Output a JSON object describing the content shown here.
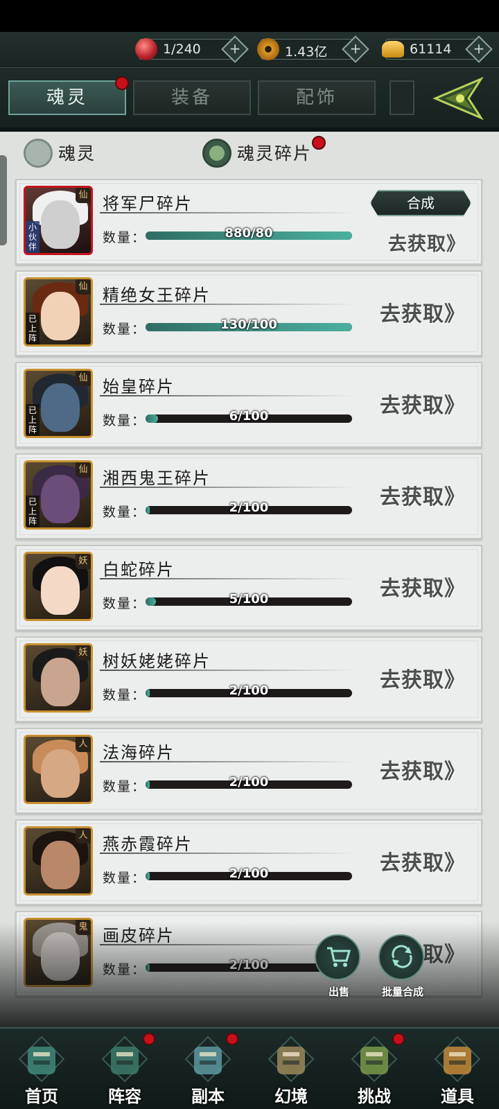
{
  "resources": [
    {
      "name": "soul-orb",
      "value": "1/240",
      "color": "#c4323a"
    },
    {
      "name": "coin",
      "value": "1.43亿",
      "color": "#c98a1e"
    },
    {
      "name": "ingot",
      "value": "61114",
      "color": "#e0a92a"
    }
  ],
  "tabs": [
    {
      "label": "魂灵",
      "active": true,
      "badge": true
    },
    {
      "label": "装备",
      "active": false,
      "badge": false
    },
    {
      "label": "配饰",
      "active": false,
      "badge": false
    }
  ],
  "subtabs": [
    {
      "label": "魂灵",
      "selected": false,
      "badge": false
    },
    {
      "label": "魂灵碎片",
      "selected": true,
      "badge": true
    }
  ],
  "qty_label": "数量：",
  "go_label": "去获取》",
  "compose_label": "合成",
  "fragments": [
    {
      "name": "将军尸碎片",
      "current": 880,
      "required": 80,
      "text": "880/80",
      "grade": "仙",
      "tag": "小伙伴",
      "frame": "red",
      "compose": true
    },
    {
      "name": "精绝女王碎片",
      "current": 130,
      "required": 100,
      "text": "130/100",
      "grade": "仙",
      "tag": "已上阵",
      "frame": "gold",
      "compose": false
    },
    {
      "name": "始皇碎片",
      "current": 6,
      "required": 100,
      "text": "6/100",
      "grade": "仙",
      "tag": "已上阵",
      "frame": "gold",
      "compose": false
    },
    {
      "name": "湘西鬼王碎片",
      "current": 2,
      "required": 100,
      "text": "2/100",
      "grade": "仙",
      "tag": "已上阵",
      "frame": "gold",
      "compose": false
    },
    {
      "name": "白蛇碎片",
      "current": 5,
      "required": 100,
      "text": "5/100",
      "grade": "妖",
      "tag": "",
      "frame": "gold",
      "compose": false
    },
    {
      "name": "树妖姥姥碎片",
      "current": 2,
      "required": 100,
      "text": "2/100",
      "grade": "妖",
      "tag": "",
      "frame": "gold",
      "compose": false
    },
    {
      "name": "法海碎片",
      "current": 2,
      "required": 100,
      "text": "2/100",
      "grade": "人",
      "tag": "",
      "frame": "gold",
      "compose": false
    },
    {
      "name": "燕赤霞碎片",
      "current": 2,
      "required": 100,
      "text": "2/100",
      "grade": "人",
      "tag": "",
      "frame": "gold",
      "compose": false
    },
    {
      "name": "画皮碎片",
      "current": 2,
      "required": 100,
      "text": "2/100",
      "grade": "鬼",
      "tag": "",
      "frame": "gold",
      "compose": false
    }
  ],
  "actions": {
    "sell": "出售",
    "batch_compose": "批量合成"
  },
  "nav": [
    {
      "label": "首页",
      "icon": "home-icon",
      "badge": false
    },
    {
      "label": "阵容",
      "icon": "lineup-icon",
      "badge": true
    },
    {
      "label": "副本",
      "icon": "dungeon-icon",
      "badge": true
    },
    {
      "label": "幻境",
      "icon": "illusion-icon",
      "badge": false
    },
    {
      "label": "挑战",
      "icon": "challenge-icon",
      "badge": true
    },
    {
      "label": "道具",
      "icon": "items-icon",
      "badge": false
    }
  ]
}
